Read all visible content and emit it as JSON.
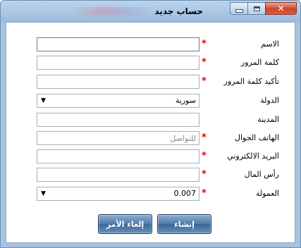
{
  "window": {
    "title": "حساب جديد",
    "close_glyph": "✕"
  },
  "form": {
    "fields": [
      {
        "label": "الاسم",
        "required": true,
        "value": "",
        "placeholder": ""
      },
      {
        "label": "كلمة المرور",
        "required": true,
        "value": "",
        "placeholder": ""
      },
      {
        "label": "تأكيد كلمة المرور",
        "required": true,
        "value": "",
        "placeholder": ""
      },
      {
        "label": "الدولة",
        "required": false,
        "value": "سورية"
      },
      {
        "label": "المدينة",
        "required": false,
        "value": "",
        "placeholder": ""
      },
      {
        "label": "الهاتف الجوال",
        "required": true,
        "value": "",
        "placeholder": "للتواصل"
      },
      {
        "label": "البريد الالكتروني",
        "required": true,
        "value": "",
        "placeholder": ""
      },
      {
        "label": "رأس المال",
        "required": true,
        "value": "",
        "placeholder": ""
      },
      {
        "label": "العمولة",
        "required": true,
        "value": "0.007"
      }
    ],
    "required_mark": "*",
    "dropdown_arrow": "▼"
  },
  "buttons": {
    "create": "إنشاء",
    "cancel": "إلغاء الأمر"
  }
}
